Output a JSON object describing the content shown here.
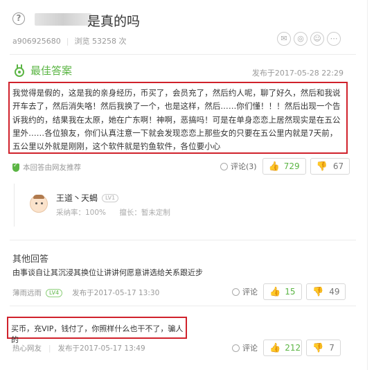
{
  "question": {
    "title": "是真的吗",
    "author": "a906925680",
    "views": "浏览 53258 次",
    "share_icons": [
      "wechat-icon",
      "weibo-icon",
      "qq-icon",
      "more-icon"
    ]
  },
  "best_answer": {
    "label": "最佳答案",
    "date": "发布于2017-05-28 22:29",
    "text": "我觉得是假的，这是我的亲身经历，币买了，会员充了，然后约人呢，聊了好久，然后和我说开车去了，然后消失咯！然后我换了一个，也是这样，然后……你们懂！！！然后出现一个告诉我约的，结果我在太原，她在广东啊！神啊，恶搞吗！可是在单身恋恋上居然现实是在五公里外……各位狼友，你们认真注意一下就会发现恋恋上那些女的只要在五公里内就是7天前，五公里以外就是刚刚，这个软件就是钓鱼软件，各位要小心",
    "recommend": "本回答由网友推荐",
    "comments": "评论(3)",
    "upvotes": "729",
    "downvotes": "67",
    "user": {
      "name": "王道丶天蝎",
      "level": "LV1",
      "adoption": "采纳率：100%",
      "specialty": "擅长：暂未定制"
    }
  },
  "other_answers": {
    "title": "其他回答",
    "question_text": "由事谈自让其沉浸其换位让讲讲何愿意讲选给关系跟近步",
    "items": [
      {
        "user": "薄雨远雨",
        "level": "LV4",
        "date": "发布于2017-05-17 13:30",
        "comment": "评论",
        "upvotes": "15",
        "downvotes": "49"
      },
      {
        "text": "买币，充VIP，钱付了，你照样什么也干不了，骗人的",
        "user": "热心网友",
        "date": "发布于2017-05-17 13:49",
        "comment": "评论",
        "upvotes": "212",
        "downvotes": "7"
      }
    ]
  },
  "colors": {
    "accent_green": "#5bb544",
    "highlight_red": "#d0212b",
    "muted_gray": "#999999"
  }
}
